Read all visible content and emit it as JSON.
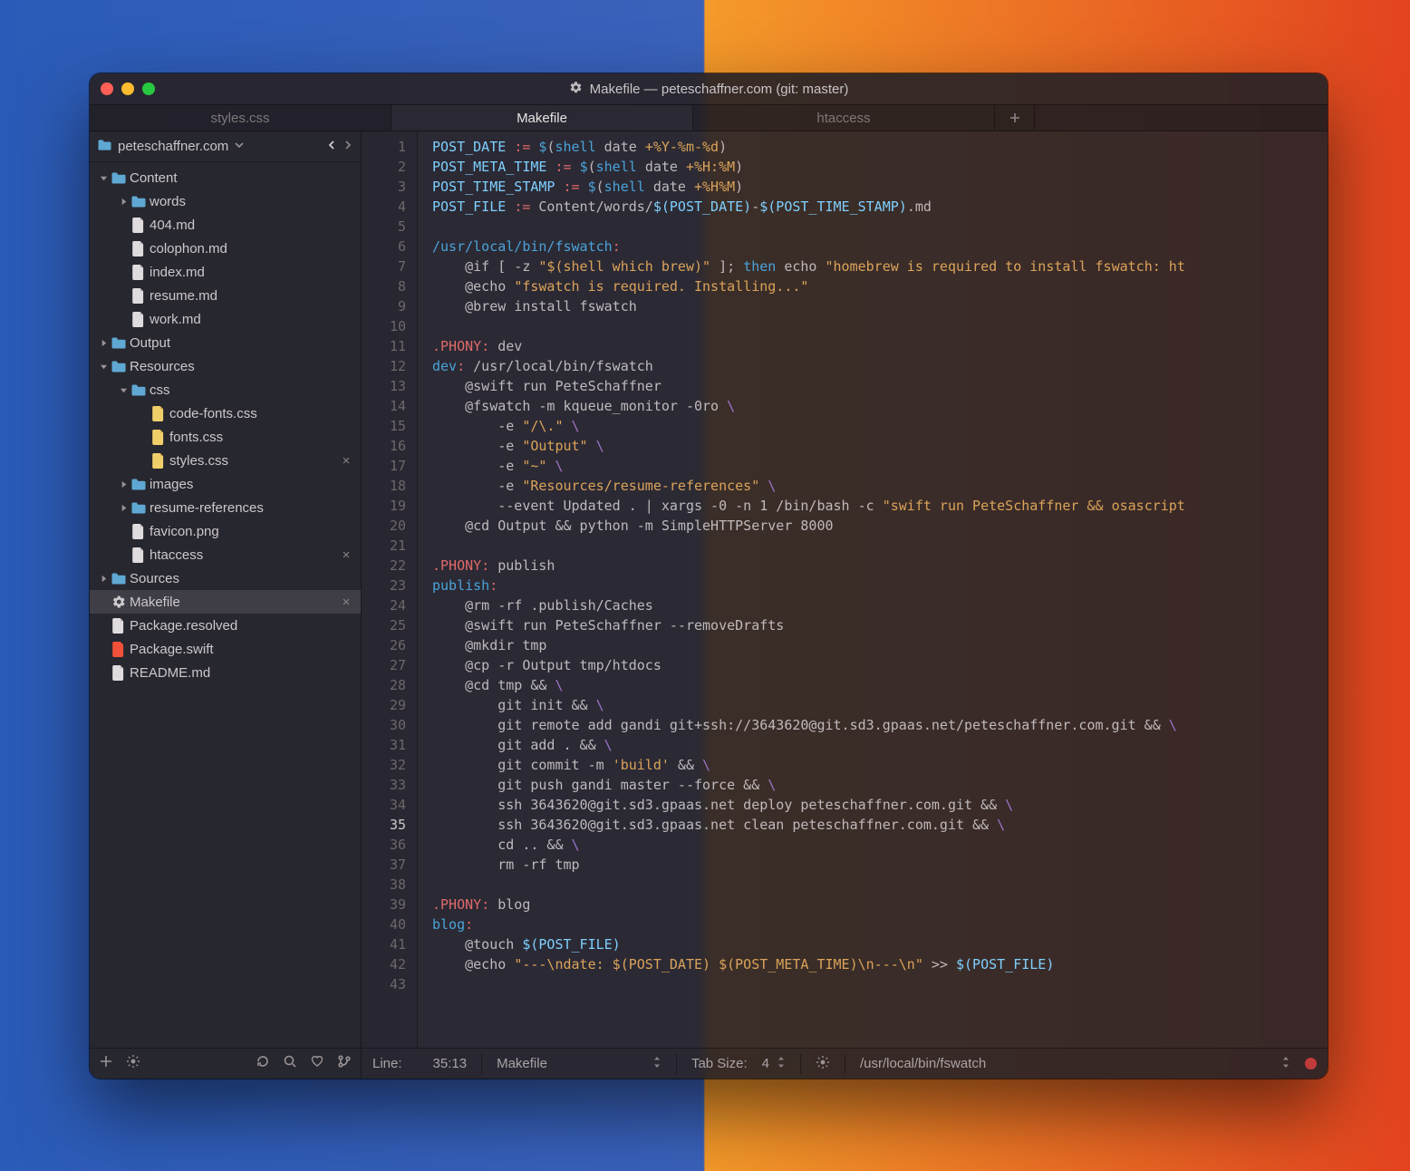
{
  "window": {
    "title": "Makefile — peteschaffner.com (git: master)"
  },
  "tabs": [
    {
      "label": "styles.css",
      "active": false
    },
    {
      "label": "Makefile",
      "active": true
    },
    {
      "label": "htaccess",
      "active": false
    }
  ],
  "sidebar": {
    "root": "peteschaffner.com",
    "tree": [
      {
        "d": 0,
        "kind": "folder",
        "arrow": "down",
        "label": "Content"
      },
      {
        "d": 1,
        "kind": "folder",
        "arrow": "right",
        "label": "words"
      },
      {
        "d": 1,
        "kind": "file",
        "label": "404.md"
      },
      {
        "d": 1,
        "kind": "file",
        "label": "colophon.md"
      },
      {
        "d": 1,
        "kind": "file",
        "label": "index.md"
      },
      {
        "d": 1,
        "kind": "file",
        "label": "resume.md"
      },
      {
        "d": 1,
        "kind": "file",
        "label": "work.md"
      },
      {
        "d": 0,
        "kind": "folder",
        "arrow": "right",
        "label": "Output"
      },
      {
        "d": 0,
        "kind": "folder",
        "arrow": "down",
        "label": "Resources"
      },
      {
        "d": 1,
        "kind": "folder",
        "arrow": "down",
        "label": "css"
      },
      {
        "d": 2,
        "kind": "cssfile",
        "label": "code-fonts.css"
      },
      {
        "d": 2,
        "kind": "cssfile",
        "label": "fonts.css"
      },
      {
        "d": 2,
        "kind": "cssfile",
        "label": "styles.css",
        "close": true
      },
      {
        "d": 1,
        "kind": "folder",
        "arrow": "right",
        "label": "images"
      },
      {
        "d": 1,
        "kind": "folder",
        "arrow": "right",
        "label": "resume-references"
      },
      {
        "d": 1,
        "kind": "file",
        "label": "favicon.png"
      },
      {
        "d": 1,
        "kind": "file",
        "label": "htaccess",
        "close": true
      },
      {
        "d": 0,
        "kind": "folder",
        "arrow": "right",
        "label": "Sources"
      },
      {
        "d": 0,
        "kind": "gear",
        "label": "Makefile",
        "selected": true,
        "close": true
      },
      {
        "d": 0,
        "kind": "file",
        "label": "Package.resolved"
      },
      {
        "d": 0,
        "kind": "swift",
        "label": "Package.swift"
      },
      {
        "d": 0,
        "kind": "file",
        "label": "README.md"
      }
    ]
  },
  "editor": {
    "cursor_line": 35,
    "lines": [
      [
        [
          "var",
          "POST_DATE"
        ],
        [
          "p",
          " "
        ],
        [
          "op",
          ":="
        ],
        [
          "p",
          " "
        ],
        [
          "func",
          "$"
        ],
        [
          "p",
          "("
        ],
        [
          "func",
          "shell"
        ],
        [
          "p",
          " "
        ],
        [
          "p",
          "date "
        ],
        [
          "str",
          "+%Y-%m-%d"
        ],
        [
          "p",
          ")"
        ]
      ],
      [
        [
          "var",
          "POST_META_TIME"
        ],
        [
          "p",
          " "
        ],
        [
          "op",
          ":="
        ],
        [
          "p",
          " "
        ],
        [
          "func",
          "$"
        ],
        [
          "p",
          "("
        ],
        [
          "func",
          "shell"
        ],
        [
          "p",
          " "
        ],
        [
          "p",
          "date "
        ],
        [
          "str",
          "+%H:%M"
        ],
        [
          "p",
          ")"
        ]
      ],
      [
        [
          "var",
          "POST_TIME_STAMP"
        ],
        [
          "p",
          " "
        ],
        [
          "op",
          ":="
        ],
        [
          "p",
          " "
        ],
        [
          "func",
          "$"
        ],
        [
          "p",
          "("
        ],
        [
          "func",
          "shell"
        ],
        [
          "p",
          " "
        ],
        [
          "p",
          "date "
        ],
        [
          "str",
          "+%H%M"
        ],
        [
          "p",
          ")"
        ]
      ],
      [
        [
          "var",
          "POST_FILE"
        ],
        [
          "p",
          " "
        ],
        [
          "op",
          ":="
        ],
        [
          "p",
          " Content/words/"
        ],
        [
          "subst",
          "$(POST_DATE)"
        ],
        [
          "p",
          "-"
        ],
        [
          "subst",
          "$(POST_TIME_STAMP)"
        ],
        [
          "p",
          ".md"
        ]
      ],
      [],
      [
        [
          "target",
          "/usr/local/bin/fswatch"
        ],
        [
          "op",
          ":"
        ]
      ],
      [
        [
          "p",
          "    @if [ -z "
        ],
        [
          "str",
          "\"$(shell which brew)\""
        ],
        [
          "p",
          " ]; "
        ],
        [
          "kw",
          "then"
        ],
        [
          "p",
          " echo "
        ],
        [
          "str",
          "\"homebrew is required to install fswatch: ht"
        ]
      ],
      [
        [
          "p",
          "    @echo "
        ],
        [
          "str",
          "\"fswatch is required. Installing...\""
        ]
      ],
      [
        [
          "p",
          "    @brew install fswatch"
        ]
      ],
      [],
      [
        [
          "op",
          ".PHONY"
        ],
        [
          "op",
          ":"
        ],
        [
          "p",
          " dev"
        ]
      ],
      [
        [
          "target",
          "dev"
        ],
        [
          "op",
          ":"
        ],
        [
          "p",
          " /usr/local/bin/fswatch"
        ]
      ],
      [
        [
          "p",
          "    @swift run PeteSchaffner"
        ]
      ],
      [
        [
          "p",
          "    @fswatch -m kqueue_monitor -0ro "
        ],
        [
          "cont",
          "\\"
        ]
      ],
      [
        [
          "p",
          "        -e "
        ],
        [
          "str",
          "\"/\\.\""
        ],
        [
          "p",
          " "
        ],
        [
          "cont",
          "\\"
        ]
      ],
      [
        [
          "p",
          "        -e "
        ],
        [
          "str",
          "\"Output\""
        ],
        [
          "p",
          " "
        ],
        [
          "cont",
          "\\"
        ]
      ],
      [
        [
          "p",
          "        -e "
        ],
        [
          "str",
          "\"~\""
        ],
        [
          "p",
          " "
        ],
        [
          "cont",
          "\\"
        ]
      ],
      [
        [
          "p",
          "        -e "
        ],
        [
          "str",
          "\"Resources/resume-references\""
        ],
        [
          "p",
          " "
        ],
        [
          "cont",
          "\\"
        ]
      ],
      [
        [
          "p",
          "        --event Updated . | xargs -0 -n 1 /bin/bash -c "
        ],
        [
          "str",
          "\"swift run PeteSchaffner && osascript"
        ]
      ],
      [
        [
          "p",
          "    @cd Output && python -m SimpleHTTPServer 8000"
        ]
      ],
      [],
      [
        [
          "op",
          ".PHONY"
        ],
        [
          "op",
          ":"
        ],
        [
          "p",
          " publish"
        ]
      ],
      [
        [
          "target",
          "publish"
        ],
        [
          "op",
          ":"
        ]
      ],
      [
        [
          "p",
          "    @rm -rf .publish/Caches"
        ]
      ],
      [
        [
          "p",
          "    @swift run PeteSchaffner --removeDrafts"
        ]
      ],
      [
        [
          "p",
          "    @mkdir tmp"
        ]
      ],
      [
        [
          "p",
          "    @cp -r Output tmp/htdocs"
        ]
      ],
      [
        [
          "p",
          "    @cd tmp && "
        ],
        [
          "cont",
          "\\"
        ]
      ],
      [
        [
          "p",
          "        git init && "
        ],
        [
          "cont",
          "\\"
        ]
      ],
      [
        [
          "p",
          "        git remote add gandi git+ssh://3643620@git.sd3.gpaas.net/peteschaffner.com.git && "
        ],
        [
          "cont",
          "\\"
        ]
      ],
      [
        [
          "p",
          "        git add . && "
        ],
        [
          "cont",
          "\\"
        ]
      ],
      [
        [
          "p",
          "        git commit -m "
        ],
        [
          "str",
          "'build'"
        ],
        [
          "p",
          " && "
        ],
        [
          "cont",
          "\\"
        ]
      ],
      [
        [
          "p",
          "        git push gandi master --force && "
        ],
        [
          "cont",
          "\\"
        ]
      ],
      [
        [
          "p",
          "        ssh 3643620@git.sd3.gpaas.net deploy peteschaffner.com.git && "
        ],
        [
          "cont",
          "\\"
        ]
      ],
      [
        [
          "p",
          "        ssh 3643620@git.sd3.gpaas.net clean peteschaffner.com.git && "
        ],
        [
          "cont",
          "\\"
        ]
      ],
      [
        [
          "p",
          "        cd .. && "
        ],
        [
          "cont",
          "\\"
        ]
      ],
      [
        [
          "p",
          "        rm -rf tmp"
        ]
      ],
      [],
      [
        [
          "op",
          ".PHONY"
        ],
        [
          "op",
          ":"
        ],
        [
          "p",
          " blog"
        ]
      ],
      [
        [
          "target",
          "blog"
        ],
        [
          "op",
          ":"
        ]
      ],
      [
        [
          "p",
          "    @touch "
        ],
        [
          "subst",
          "$(POST_FILE)"
        ]
      ],
      [
        [
          "p",
          "    @echo "
        ],
        [
          "str",
          "\"---\\ndate: $(POST_DATE) $(POST_META_TIME)\\n---\\n\""
        ],
        [
          "p",
          " >> "
        ],
        [
          "subst",
          "$(POST_FILE)"
        ]
      ],
      []
    ]
  },
  "status": {
    "line_label": "Line:",
    "line_value": "35:13",
    "syntax": "Makefile",
    "tab_label": "Tab Size:",
    "tab_value": "4",
    "path": "/usr/local/bin/fswatch"
  }
}
